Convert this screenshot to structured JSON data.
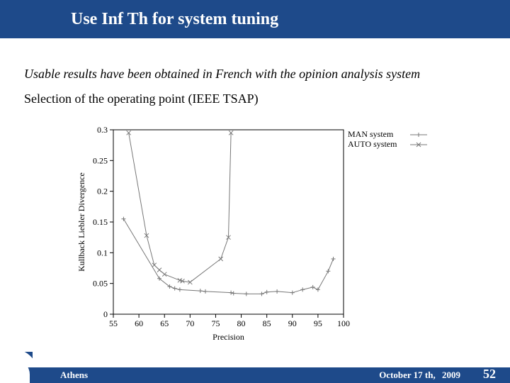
{
  "header": {
    "title": "Use Inf  Th for system tuning"
  },
  "body": {
    "line1": "Usable results have been obtained in French with the opinion analysis system",
    "line2": "Selection of the operating point (IEEE TSAP)"
  },
  "footer": {
    "location": "Athens",
    "date": "October 17 th,",
    "year": "2009",
    "pagenum": "52"
  },
  "chart_data": {
    "type": "line",
    "xlabel": "Precision",
    "ylabel": "Kullback Liebler Divergence",
    "xlim": [
      55,
      100
    ],
    "ylim": [
      0,
      0.3
    ],
    "xticks": [
      55,
      60,
      65,
      70,
      75,
      80,
      85,
      90,
      95,
      100
    ],
    "yticks": [
      0,
      0.05,
      0.1,
      0.15,
      0.2,
      0.25,
      0.3
    ],
    "legend": {
      "position": "top-right",
      "items": [
        {
          "name": "MAN system",
          "marker": "plus"
        },
        {
          "name": "AUTO system",
          "marker": "x"
        }
      ]
    },
    "series": [
      {
        "name": "MAN system",
        "marker": "plus",
        "points": [
          [
            57,
            0.155
          ],
          [
            64,
            0.058
          ],
          [
            66,
            0.045
          ],
          [
            67,
            0.042
          ],
          [
            68,
            0.04
          ],
          [
            72,
            0.038
          ],
          [
            73,
            0.037
          ],
          [
            78,
            0.035
          ],
          [
            78.5,
            0.034
          ],
          [
            81,
            0.033
          ],
          [
            84,
            0.033
          ],
          [
            85,
            0.036
          ],
          [
            87,
            0.037
          ],
          [
            90,
            0.035
          ],
          [
            92,
            0.04
          ],
          [
            94,
            0.044
          ],
          [
            95,
            0.04
          ],
          [
            97,
            0.07
          ],
          [
            98,
            0.09
          ]
        ]
      },
      {
        "name": "AUTO system",
        "marker": "x",
        "points": [
          [
            58,
            0.295
          ],
          [
            61.5,
            0.128
          ],
          [
            63,
            0.08
          ],
          [
            64,
            0.072
          ],
          [
            65,
            0.065
          ],
          [
            68,
            0.055
          ],
          [
            68.5,
            0.054
          ],
          [
            70,
            0.052
          ],
          [
            76,
            0.09
          ],
          [
            77.5,
            0.125
          ],
          [
            78,
            0.295
          ]
        ]
      }
    ]
  }
}
